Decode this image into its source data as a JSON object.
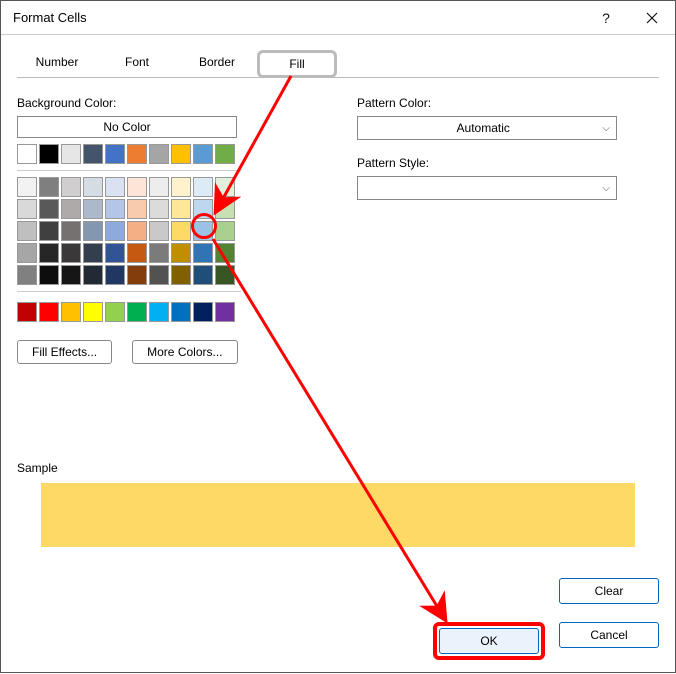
{
  "window": {
    "title": "Format Cells"
  },
  "tabs": {
    "items": [
      {
        "label": "Number"
      },
      {
        "label": "Font"
      },
      {
        "label": "Border"
      },
      {
        "label": "Fill"
      }
    ],
    "active": "Fill"
  },
  "fill": {
    "bg_label": "Background Color:",
    "no_color": "No Color",
    "fill_effects": "Fill Effects...",
    "more_colors": "More Colors...",
    "pattern_color_label": "Pattern Color:",
    "pattern_color_value": "Automatic",
    "pattern_style_label": "Pattern Style:",
    "pattern_style_value": ""
  },
  "sample": {
    "label": "Sample",
    "color": "#ffd966"
  },
  "footer": {
    "clear": "Clear",
    "ok": "OK",
    "cancel": "Cancel"
  },
  "palette": {
    "row1": [
      "#ffffff",
      "#000000",
      "#e7e6e6",
      "#44546a",
      "#4472c4",
      "#ed7d31",
      "#a5a5a5",
      "#ffc000",
      "#5b9bd5",
      "#70ad47"
    ],
    "row2": [
      "#f2f2f2",
      "#7f7f7f",
      "#d0cece",
      "#d6dce4",
      "#d9e1f2",
      "#fce4d6",
      "#ededed",
      "#fff2cc",
      "#ddebf7",
      "#e2efda"
    ],
    "row3": [
      "#d9d9d9",
      "#595959",
      "#aeaaaa",
      "#acb9ca",
      "#b4c6e7",
      "#f8cbad",
      "#dbdbdb",
      "#ffe699",
      "#bdd7ee",
      "#c6e0b4"
    ],
    "row4": [
      "#bfbfbf",
      "#404040",
      "#757171",
      "#8497b0",
      "#8ea9db",
      "#f4b084",
      "#c9c9c9",
      "#ffd966",
      "#9bc2e6",
      "#a9d08e"
    ],
    "row5": [
      "#a6a6a6",
      "#262626",
      "#3a3838",
      "#333f4f",
      "#305496",
      "#c65911",
      "#7b7b7b",
      "#bf8f00",
      "#2f75b5",
      "#548235"
    ],
    "row6": [
      "#808080",
      "#0d0d0d",
      "#161616",
      "#222b35",
      "#203764",
      "#833c0c",
      "#525252",
      "#806000",
      "#1f4e78",
      "#375623"
    ],
    "std": [
      "#c00000",
      "#ff0000",
      "#ffc000",
      "#ffff00",
      "#92d050",
      "#00b050",
      "#00b0f0",
      "#0070c0",
      "#002060",
      "#7030a0"
    ]
  }
}
